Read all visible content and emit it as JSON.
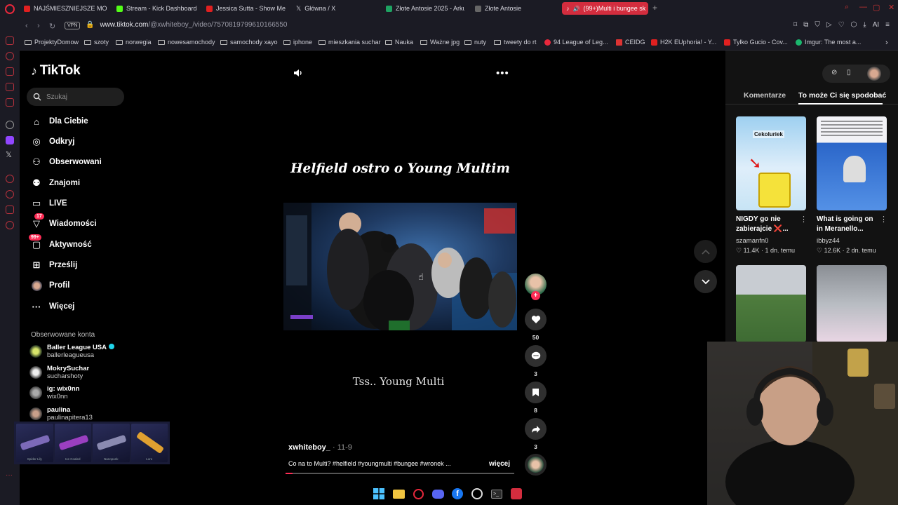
{
  "browser": {
    "tabs": [
      {
        "label": "NAJŚMIESZNIEJSZE MOM",
        "color": "#e02020"
      },
      {
        "label": "Stream - Kick Dashboard",
        "color": "#53fc18"
      },
      {
        "label": "Jessica Sutta - Show Me",
        "color": "#e02020"
      },
      {
        "label": "Główna / X",
        "color": "#ffffff"
      },
      {
        "label": "Złote Antosie 2025 - Arku",
        "color": "#1ea362"
      },
      {
        "label": "Złote Antosie",
        "color": "#cccccc"
      },
      {
        "label": "(99+)Multi i bungee sk",
        "color": "#ffffff"
      }
    ],
    "url_host": "www.tiktok.com",
    "url_path": "/@xwhiteboy_/video/7570819799610166550",
    "vpn_label": "VPN",
    "bookmarks": [
      "ProjektyDomow",
      "szoty",
      "norwegia",
      "nowesamochody",
      "samochody xayo",
      "iphone",
      "mieszkania suchar",
      "Nauka",
      "Ważne jpg",
      "nuty",
      "tweety do rt",
      "94 League of Leg...",
      "CEIDG",
      "H2K EUphoria! - Y...",
      "Tylko Gucio - Cov...",
      "Imgur: The most a..."
    ],
    "ai_label": "AI"
  },
  "sidebar": {
    "logo": "TikTok",
    "search_placeholder": "Szukaj",
    "menu": [
      {
        "label": "Dla Ciebie",
        "icon": "home-icon"
      },
      {
        "label": "Odkryj",
        "icon": "compass-icon"
      },
      {
        "label": "Obserwowani",
        "icon": "following-icon"
      },
      {
        "label": "Znajomi",
        "icon": "friends-icon"
      },
      {
        "label": "LIVE",
        "icon": "live-icon"
      },
      {
        "label": "Wiadomości",
        "icon": "messages-icon",
        "badge": "17"
      },
      {
        "label": "Aktywność",
        "icon": "activity-icon",
        "badge": "99+"
      },
      {
        "label": "Prześlij",
        "icon": "upload-icon"
      },
      {
        "label": "Profil",
        "icon": "profile-icon"
      },
      {
        "label": "Więcej",
        "icon": "more-icon"
      }
    ],
    "following_header": "Obserwowane konta",
    "accounts": [
      {
        "name": "Baller League USA",
        "handle": "ballerleagueusa",
        "verified": true
      },
      {
        "name": "MokrySuchar",
        "handle": "sucharshoty"
      },
      {
        "name": "ig: wix0nn",
        "handle": "wix0nn"
      },
      {
        "name": "paulina",
        "handle": "paulinapitera13"
      }
    ]
  },
  "overlay": {
    "weapons": [
      "Spider Lily",
      "Ice Coaled",
      "Nanopunk",
      "Lore"
    ]
  },
  "video": {
    "title": "Helfield ostro o Young Multim",
    "caption": "Tss.. Young Multi",
    "author": "xwhiteboy_",
    "date": "11-9",
    "description": "Co na to Multi? #helfield #youngmulti #bungee #wronek ...",
    "more_label": "więcej",
    "progress": 0.03,
    "likes": "50",
    "comments": "3",
    "saves": "8",
    "shares": "3"
  },
  "right_panel": {
    "tabs": [
      "Komentarze",
      "To może Ci się spodobać"
    ],
    "active_tab": 1,
    "videos": [
      {
        "title": "NIGDY go nie zabierajcie ❌...",
        "author": "szamanfn0",
        "likes": "11.4K",
        "age": "1 dn. temu",
        "thumb_text": "Cekoluriek"
      },
      {
        "title": "What is going on in Meranello...",
        "author": "ibbyz44",
        "likes": "12.6K",
        "age": "2 dn. temu"
      }
    ]
  },
  "colors": {
    "accent": "#fe2c55",
    "opera": "#e8283c",
    "chrome_bg": "#1b1b24"
  }
}
